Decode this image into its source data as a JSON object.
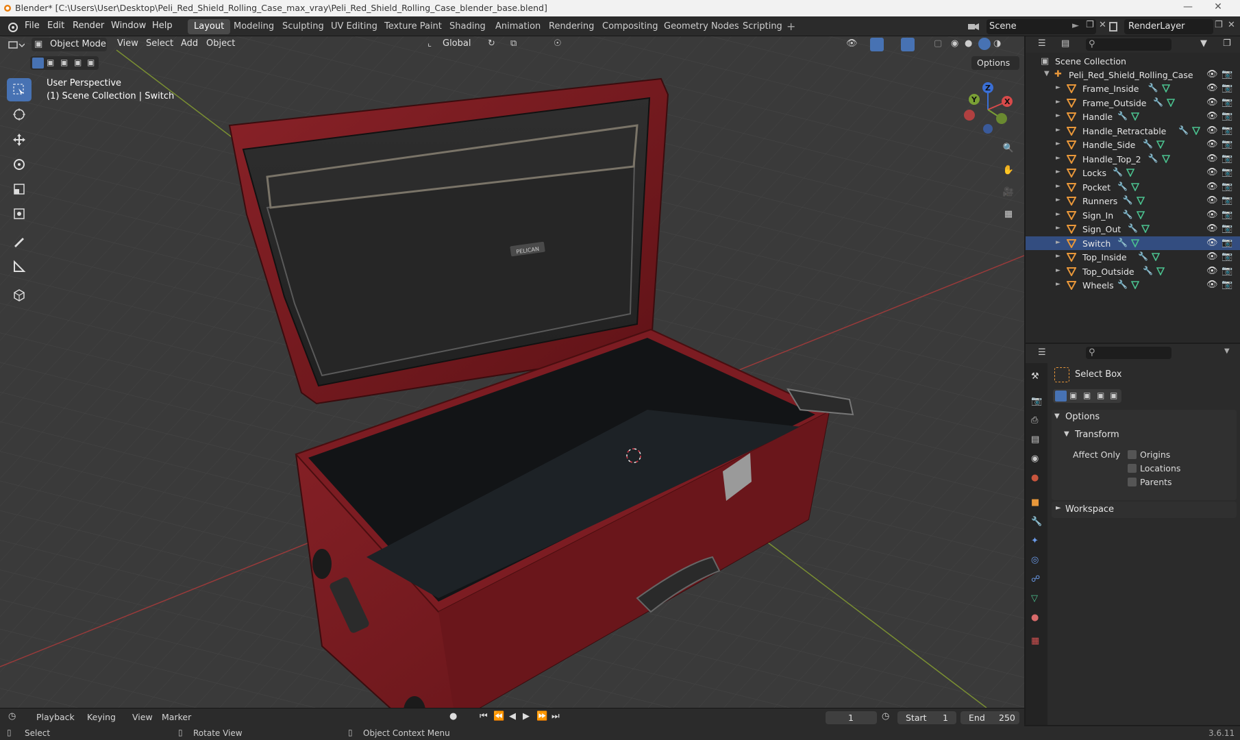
{
  "titlebar": {
    "title": "Blender* [C:\\Users\\User\\Desktop\\Peli_Red_Shield_Rolling_Case_max_vray\\Peli_Red_Shield_Rolling_Case_blender_base.blend]"
  },
  "menu": [
    "File",
    "Edit",
    "Render",
    "Window",
    "Help"
  ],
  "workspaces": [
    "Layout",
    "Modeling",
    "Sculpting",
    "UV Editing",
    "Texture Paint",
    "Shading",
    "Animation",
    "Rendering",
    "Compositing",
    "Geometry Nodes",
    "Scripting"
  ],
  "active_workspace": "Layout",
  "scene": {
    "label": "Scene"
  },
  "render_layer": {
    "label": "RenderLayer"
  },
  "viewport": {
    "mode": "Object Mode",
    "menus": [
      "View",
      "Select",
      "Add",
      "Object"
    ],
    "transform_orientation": "Global",
    "options_label": "Options",
    "perspective_label": "User Perspective",
    "context_label": "(1) Scene Collection | Switch",
    "gizmo": {
      "x": "X",
      "y": "Y",
      "z": "Z"
    },
    "case_label": "PELICAN"
  },
  "outliner": {
    "root": "Scene Collection",
    "collection": "Peli_Red_Shield_Rolling_Case",
    "objects": [
      "Frame_Inside",
      "Frame_Outside",
      "Handle",
      "Handle_Retractable",
      "Handle_Side",
      "Handle_Top_2",
      "Locks",
      "Pocket",
      "Runners",
      "Sign_In",
      "Sign_Out",
      "Switch",
      "Top_Inside",
      "Top_Outside",
      "Wheels"
    ],
    "active_object": "Switch"
  },
  "properties": {
    "tool_name": "Select Box",
    "options_label": "Options",
    "transform_label": "Transform",
    "affect_only_label": "Affect Only",
    "checkboxes": [
      "Origins",
      "Locations",
      "Parents"
    ],
    "workspace_label": "Workspace"
  },
  "timeline": {
    "menus": [
      "Playback",
      "Keying",
      "View",
      "Marker"
    ],
    "current_frame": "1",
    "start_label": "Start",
    "start": "1",
    "end_label": "End",
    "end": "250"
  },
  "statusbar": {
    "select": "Select",
    "rotate": "Rotate View",
    "context": "Object Context Menu",
    "version": "3.6.11"
  },
  "colors": {
    "accent": "#4772b3",
    "case_red": "#7a1a1e",
    "grid_x": "#b23a3a",
    "grid_y": "#7f9a2e"
  }
}
